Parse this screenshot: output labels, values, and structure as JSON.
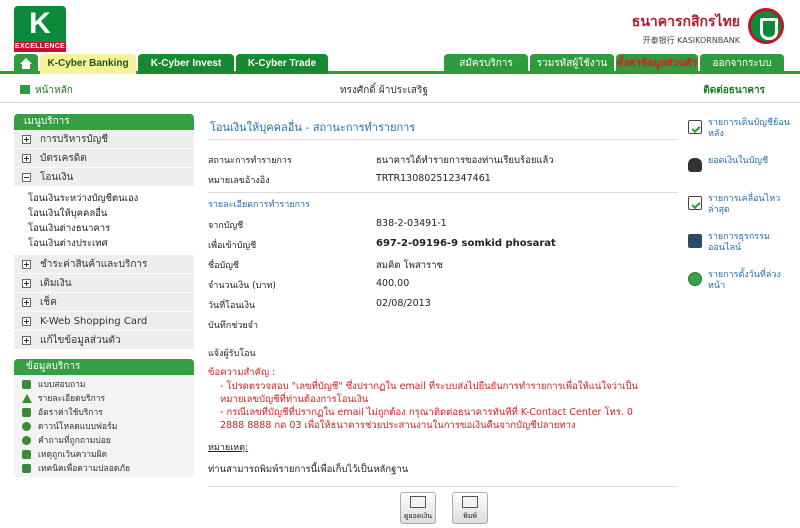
{
  "header": {
    "logo_letter": "K",
    "logo_tag": "EXCELLENCE",
    "bank_name_thai": "ธนาคารกสิกรไทย",
    "bank_name_en": "开泰银行 KASIKORNBANK"
  },
  "tabs": [
    {
      "label": "K-Cyber Banking",
      "active": true
    },
    {
      "label": "K-Cyber Invest",
      "active": false
    },
    {
      "label": "K-Cyber Trade",
      "active": false
    }
  ],
  "right_tabs": [
    {
      "label": "สมัครบริการ"
    },
    {
      "label": "รวมรหัสผู้ใช้งาน"
    },
    {
      "label": "ตั้งค่าข้อมูลส่วนตัว"
    },
    {
      "label": "ออกจากระบบ"
    }
  ],
  "subbar": {
    "home": "หน้าหลัก",
    "user": "ทรงศักดิ์ ผ้าประเสริฐ",
    "contact": "ติดต่อธนาคาร"
  },
  "sidebar": {
    "menu_title": "เมนูบริการ",
    "items_top": [
      {
        "label": "การบริหารบัญชี",
        "expanded": false
      },
      {
        "label": "บัตรเครดิต",
        "expanded": false
      },
      {
        "label": "โอนเงิน",
        "expanded": true
      }
    ],
    "transfer_sub": [
      "โอนเงินระหว่างบัญชีตนเอง",
      "โอนเงินให้บุคคลอื่น",
      "โอนเงินต่างธนาคาร",
      "โอนเงินต่างประเทศ"
    ],
    "items_bottom": [
      {
        "label": "ชำระค่าสินค้าและบริการ"
      },
      {
        "label": "เติมเงิน"
      },
      {
        "label": "เช็ค"
      },
      {
        "label": "K-Web Shopping Card"
      },
      {
        "label": "แก้ไขข้อมูลส่วนตัว"
      }
    ],
    "info_title": "ข้อมูลบริการ",
    "info_items": [
      "แบบสอบถาม",
      "รายละเอียดบริการ",
      "อัตราค่าใช้บริการ",
      "ดาวน์โหลดแบบฟอร์ม",
      "คำถามที่ถูกถามบ่อย",
      "เหตุถูกเว้นความผิด",
      "เทคนิคเพื่อความปลอดภัย"
    ]
  },
  "main": {
    "title": "โอนเงินให้บุคคลอื่น - สถานะการทำรายการ",
    "status_label": "สถานะการทำรายการ",
    "status_value": "ธนาคารได้ทำรายการของท่านเรียบร้อยแล้ว",
    "ref_label": "หมายเลขอ้างอิง",
    "ref_value": "TRTR130802512347461",
    "details_title": "รายละเอียดการทำรายการ",
    "from_label": "จากบัญชี",
    "from_value": "838-2-03491-1",
    "to_label": "เพื่อเข้าบัญชี",
    "to_value": "697-2-09196-9 somkid phosarat",
    "name_label": "ชื่อบัญชี",
    "name_value": "สมคิด โพสาราช",
    "amount_label": "จำนวนเงิน (บาท)",
    "amount_value": "400.00",
    "date_label": "วันที่โอนเงิน",
    "date_value": "02/08/2013",
    "memo_label": "บันทึกช่วยจำ",
    "notify_label": "แจ้งผู้รับโอน",
    "notice_head": "ข้อความสำคัญ :",
    "notice_lines": [
      "- โปรดตรวจสอบ \"เลขที่บัญชี\" ซึ่งปรากฏใน email ที่ระบบส่งไปยืนยันการทำรายการเพื่อให้แน่ใจว่าเป็น",
      "หมายเลขบัญชีที่ท่านต้องการโอนเงิน",
      "- กรณีเลขที่บัญชีที่ปรากฏใน email ไม่ถูกต้อง กรุณาติดต่อธนาคารทันทีที่ K-Contact Center โทร. 0",
      "2888 8888 กด 03 เพื่อให้ธนาคารช่วยประสานงานในการขอเงินคืนจากบัญชีปลายทาง"
    ],
    "remark_head": "หมายเหตุ:",
    "remark_text": "ท่านสามารถพิมพ์รายการนี้เพื่อเก็บไว้เป็นหลักฐาน",
    "btn_view": "ดูยอดเงิน",
    "btn_print": "พิมพ์"
  },
  "quick_links": [
    {
      "label": "รายการเดินบัญชีย้อนหลัง",
      "icon": "checklist-icon"
    },
    {
      "label": "ยอดเงินในบัญชี",
      "icon": "money-bag-icon"
    },
    {
      "label": "รายการเคลื่อนไหวล่าสุด",
      "icon": "checklist-icon"
    },
    {
      "label": "รายการธุรกรรมออนไลน์",
      "icon": "screen-icon"
    },
    {
      "label": "รายการตั้งวันที่ล่วงหน้า",
      "icon": "clock-icon"
    }
  ]
}
